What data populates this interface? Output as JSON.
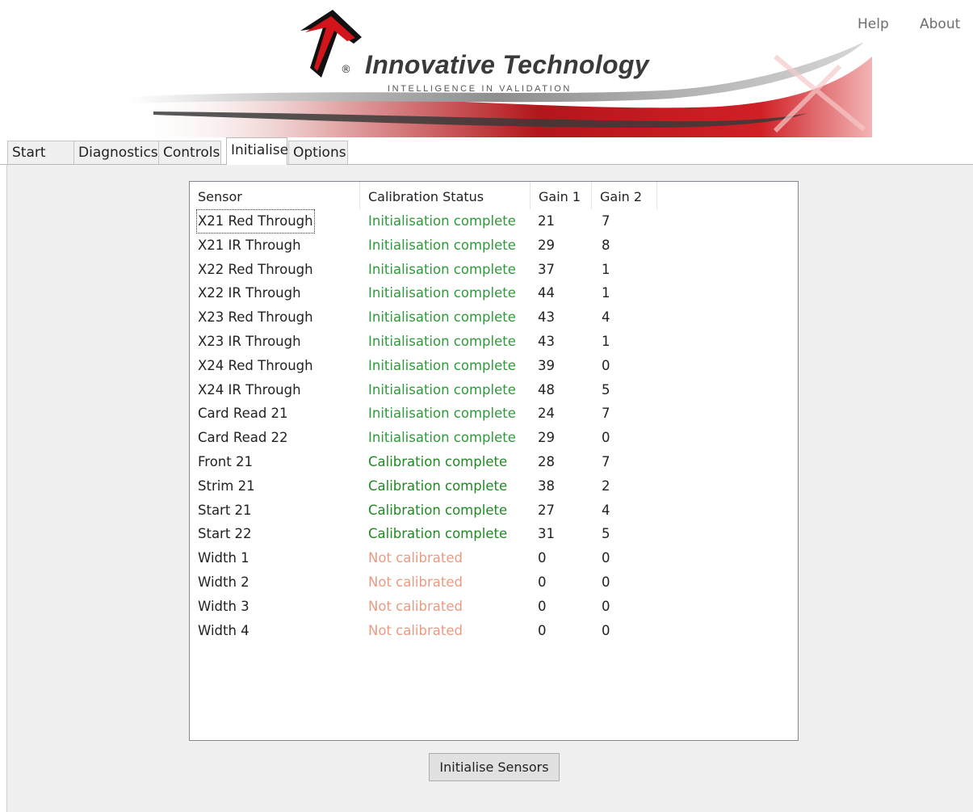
{
  "header": {
    "help_label": "Help",
    "about_label": "About",
    "brand_name": "Innovative Technology",
    "brand_mark": "®",
    "tagline": "INTELLIGENCE IN VALIDATION"
  },
  "tabs": [
    {
      "label": "Start",
      "active": false
    },
    {
      "label": "Diagnostics",
      "active": false
    },
    {
      "label": "Controls",
      "active": false
    },
    {
      "label": "Initialise",
      "active": true
    },
    {
      "label": "Options",
      "active": false
    }
  ],
  "table": {
    "columns": [
      "Sensor",
      "Calibration Status",
      "Gain 1",
      "Gain 2"
    ],
    "rows": [
      {
        "sensor": "X21 Red Through",
        "status": "Initialisation complete",
        "gain1": "21",
        "gain2": "7"
      },
      {
        "sensor": "X21 IR Through",
        "status": "Initialisation complete",
        "gain1": "29",
        "gain2": "8"
      },
      {
        "sensor": "X22 Red Through",
        "status": "Initialisation complete",
        "gain1": "37",
        "gain2": "1"
      },
      {
        "sensor": "X22 IR Through",
        "status": "Initialisation complete",
        "gain1": "44",
        "gain2": "1"
      },
      {
        "sensor": "X23 Red Through",
        "status": "Initialisation complete",
        "gain1": "43",
        "gain2": "4"
      },
      {
        "sensor": "X23 IR Through",
        "status": "Initialisation complete",
        "gain1": "43",
        "gain2": "1"
      },
      {
        "sensor": "X24 Red Through",
        "status": "Initialisation complete",
        "gain1": "39",
        "gain2": "0"
      },
      {
        "sensor": "X24 IR Through",
        "status": "Initialisation complete",
        "gain1": "48",
        "gain2": "5"
      },
      {
        "sensor": "Card Read 21",
        "status": "Initialisation complete",
        "gain1": "24",
        "gain2": "7"
      },
      {
        "sensor": "Card Read 22",
        "status": "Initialisation complete",
        "gain1": "29",
        "gain2": "0"
      },
      {
        "sensor": "Front 21",
        "status": "Calibration complete",
        "gain1": "28",
        "gain2": "7"
      },
      {
        "sensor": "Strim 21",
        "status": "Calibration complete",
        "gain1": "38",
        "gain2": "2"
      },
      {
        "sensor": "Start 21",
        "status": "Calibration complete",
        "gain1": "27",
        "gain2": "4"
      },
      {
        "sensor": "Start 22",
        "status": "Calibration complete",
        "gain1": "31",
        "gain2": "5"
      },
      {
        "sensor": "Width 1",
        "status": "Not calibrated",
        "gain1": "0",
        "gain2": "0"
      },
      {
        "sensor": "Width 2",
        "status": "Not calibrated",
        "gain1": "0",
        "gain2": "0"
      },
      {
        "sensor": "Width 3",
        "status": "Not calibrated",
        "gain1": "0",
        "gain2": "0"
      },
      {
        "sensor": "Width 4",
        "status": "Not calibrated",
        "gain1": "0",
        "gain2": "0"
      }
    ]
  },
  "status_colors": {
    "Initialisation complete": "#2e9b3a",
    "Calibration complete": "#1f8a22",
    "Not calibrated": "#ec9a82"
  },
  "actions": {
    "initialise_label": "Initialise Sensors"
  },
  "icons": {
    "logo": "innovative-technology-logo-icon"
  }
}
